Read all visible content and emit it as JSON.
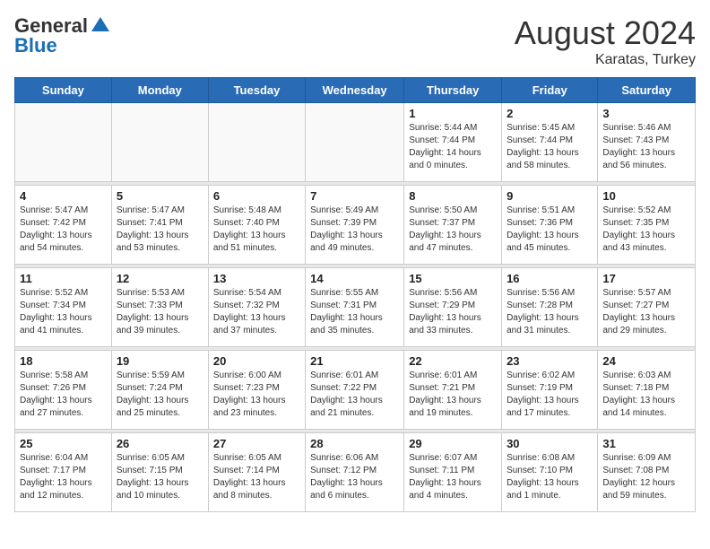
{
  "header": {
    "logo_general": "General",
    "logo_blue": "Blue",
    "month_year": "August 2024",
    "location": "Karatas, Turkey"
  },
  "days_of_week": [
    "Sunday",
    "Monday",
    "Tuesday",
    "Wednesday",
    "Thursday",
    "Friday",
    "Saturday"
  ],
  "weeks": [
    [
      {
        "day": "",
        "info": ""
      },
      {
        "day": "",
        "info": ""
      },
      {
        "day": "",
        "info": ""
      },
      {
        "day": "",
        "info": ""
      },
      {
        "day": "1",
        "info": "Sunrise: 5:44 AM\nSunset: 7:44 PM\nDaylight: 14 hours\nand 0 minutes."
      },
      {
        "day": "2",
        "info": "Sunrise: 5:45 AM\nSunset: 7:44 PM\nDaylight: 13 hours\nand 58 minutes."
      },
      {
        "day": "3",
        "info": "Sunrise: 5:46 AM\nSunset: 7:43 PM\nDaylight: 13 hours\nand 56 minutes."
      }
    ],
    [
      {
        "day": "4",
        "info": "Sunrise: 5:47 AM\nSunset: 7:42 PM\nDaylight: 13 hours\nand 54 minutes."
      },
      {
        "day": "5",
        "info": "Sunrise: 5:47 AM\nSunset: 7:41 PM\nDaylight: 13 hours\nand 53 minutes."
      },
      {
        "day": "6",
        "info": "Sunrise: 5:48 AM\nSunset: 7:40 PM\nDaylight: 13 hours\nand 51 minutes."
      },
      {
        "day": "7",
        "info": "Sunrise: 5:49 AM\nSunset: 7:39 PM\nDaylight: 13 hours\nand 49 minutes."
      },
      {
        "day": "8",
        "info": "Sunrise: 5:50 AM\nSunset: 7:37 PM\nDaylight: 13 hours\nand 47 minutes."
      },
      {
        "day": "9",
        "info": "Sunrise: 5:51 AM\nSunset: 7:36 PM\nDaylight: 13 hours\nand 45 minutes."
      },
      {
        "day": "10",
        "info": "Sunrise: 5:52 AM\nSunset: 7:35 PM\nDaylight: 13 hours\nand 43 minutes."
      }
    ],
    [
      {
        "day": "11",
        "info": "Sunrise: 5:52 AM\nSunset: 7:34 PM\nDaylight: 13 hours\nand 41 minutes."
      },
      {
        "day": "12",
        "info": "Sunrise: 5:53 AM\nSunset: 7:33 PM\nDaylight: 13 hours\nand 39 minutes."
      },
      {
        "day": "13",
        "info": "Sunrise: 5:54 AM\nSunset: 7:32 PM\nDaylight: 13 hours\nand 37 minutes."
      },
      {
        "day": "14",
        "info": "Sunrise: 5:55 AM\nSunset: 7:31 PM\nDaylight: 13 hours\nand 35 minutes."
      },
      {
        "day": "15",
        "info": "Sunrise: 5:56 AM\nSunset: 7:29 PM\nDaylight: 13 hours\nand 33 minutes."
      },
      {
        "day": "16",
        "info": "Sunrise: 5:56 AM\nSunset: 7:28 PM\nDaylight: 13 hours\nand 31 minutes."
      },
      {
        "day": "17",
        "info": "Sunrise: 5:57 AM\nSunset: 7:27 PM\nDaylight: 13 hours\nand 29 minutes."
      }
    ],
    [
      {
        "day": "18",
        "info": "Sunrise: 5:58 AM\nSunset: 7:26 PM\nDaylight: 13 hours\nand 27 minutes."
      },
      {
        "day": "19",
        "info": "Sunrise: 5:59 AM\nSunset: 7:24 PM\nDaylight: 13 hours\nand 25 minutes."
      },
      {
        "day": "20",
        "info": "Sunrise: 6:00 AM\nSunset: 7:23 PM\nDaylight: 13 hours\nand 23 minutes."
      },
      {
        "day": "21",
        "info": "Sunrise: 6:01 AM\nSunset: 7:22 PM\nDaylight: 13 hours\nand 21 minutes."
      },
      {
        "day": "22",
        "info": "Sunrise: 6:01 AM\nSunset: 7:21 PM\nDaylight: 13 hours\nand 19 minutes."
      },
      {
        "day": "23",
        "info": "Sunrise: 6:02 AM\nSunset: 7:19 PM\nDaylight: 13 hours\nand 17 minutes."
      },
      {
        "day": "24",
        "info": "Sunrise: 6:03 AM\nSunset: 7:18 PM\nDaylight: 13 hours\nand 14 minutes."
      }
    ],
    [
      {
        "day": "25",
        "info": "Sunrise: 6:04 AM\nSunset: 7:17 PM\nDaylight: 13 hours\nand 12 minutes."
      },
      {
        "day": "26",
        "info": "Sunrise: 6:05 AM\nSunset: 7:15 PM\nDaylight: 13 hours\nand 10 minutes."
      },
      {
        "day": "27",
        "info": "Sunrise: 6:05 AM\nSunset: 7:14 PM\nDaylight: 13 hours\nand 8 minutes."
      },
      {
        "day": "28",
        "info": "Sunrise: 6:06 AM\nSunset: 7:12 PM\nDaylight: 13 hours\nand 6 minutes."
      },
      {
        "day": "29",
        "info": "Sunrise: 6:07 AM\nSunset: 7:11 PM\nDaylight: 13 hours\nand 4 minutes."
      },
      {
        "day": "30",
        "info": "Sunrise: 6:08 AM\nSunset: 7:10 PM\nDaylight: 13 hours\nand 1 minute."
      },
      {
        "day": "31",
        "info": "Sunrise: 6:09 AM\nSunset: 7:08 PM\nDaylight: 12 hours\nand 59 minutes."
      }
    ]
  ]
}
